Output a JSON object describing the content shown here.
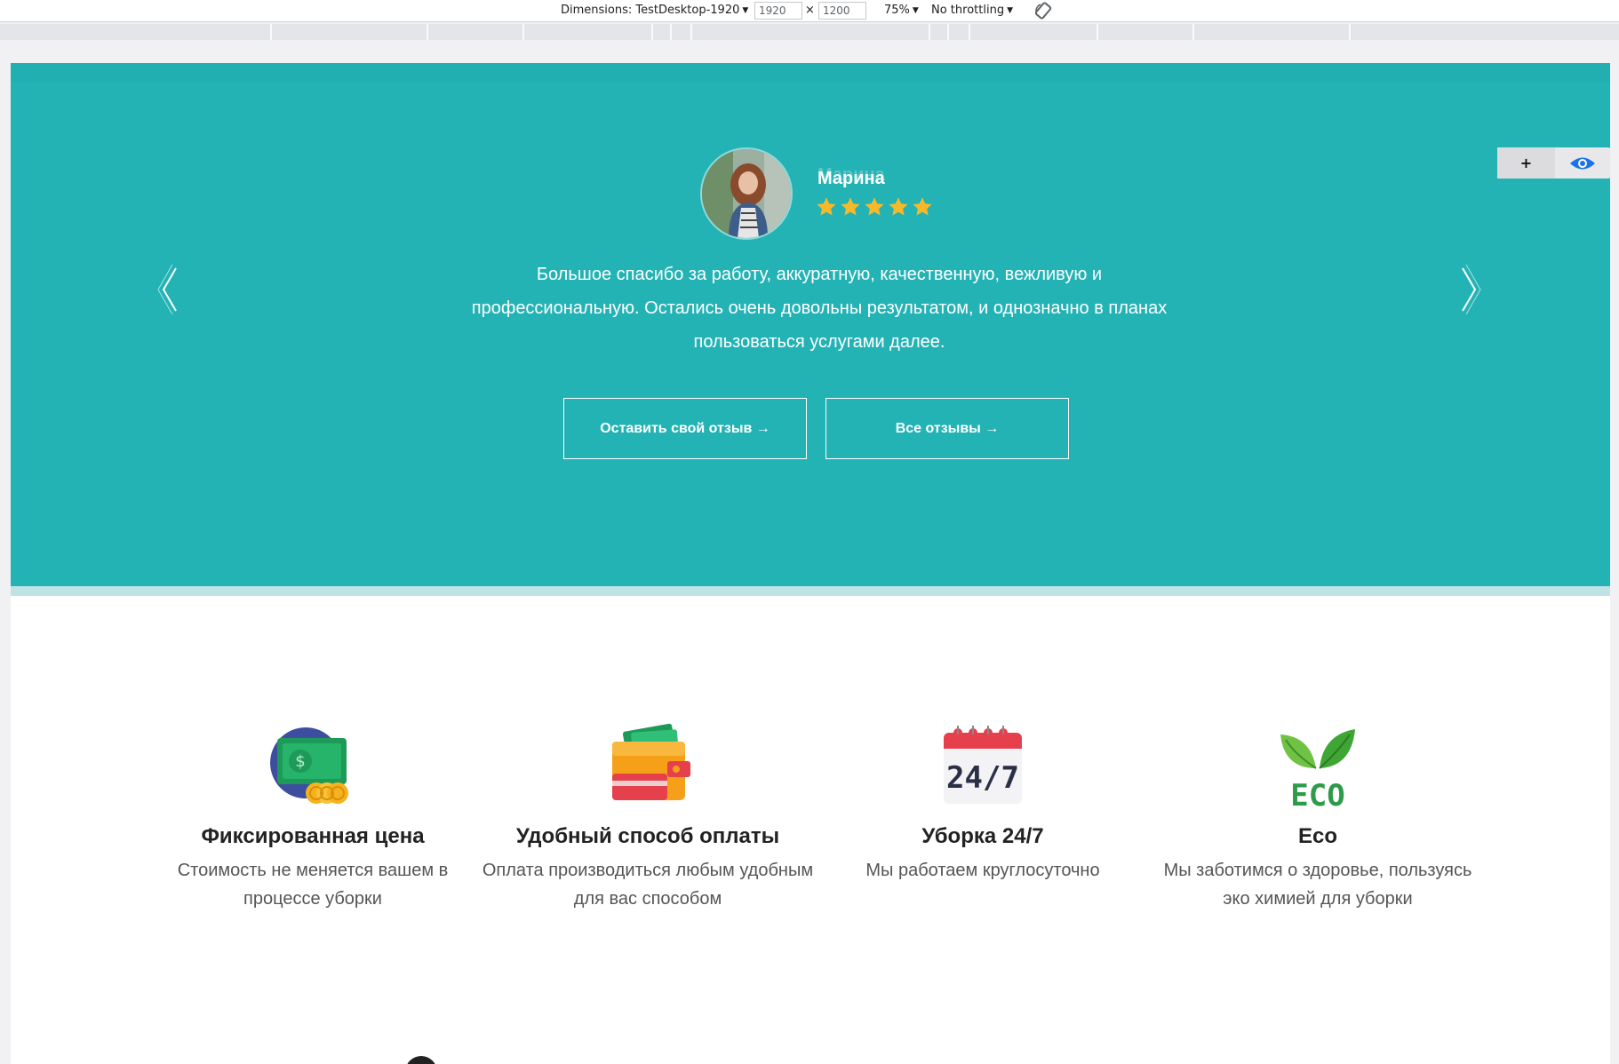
{
  "devtools": {
    "dimensions_label": "Dimensions: TestDesktop-1920",
    "width_value": "1920",
    "times": "×",
    "height_value": "1200",
    "zoom": "75%",
    "throttling": "No throttling",
    "rotate_icon": "rotate-icon"
  },
  "testimonial": {
    "name": "Марина",
    "rating": 5,
    "text": "Большое спасибо за работу, аккуратную, качественную, вежливую и профессиональную. Остались очень довольны результатом, и однозначно в планах пользоваться услугами далее.",
    "leave_review_label": "Оставить свой отзыв →",
    "all_reviews_label": "Все отзывы →",
    "prev_icon": "chevron-left-icon",
    "next_icon": "chevron-right-icon"
  },
  "widget": {
    "plus_label": "+",
    "eye_icon": "eye-icon"
  },
  "features": [
    {
      "title": "Фиксированная цена",
      "desc": "Стоимость не меняется вашем в процессе уборки",
      "icon": "money-icon"
    },
    {
      "title": "Удобный способ оплаты",
      "desc": "Оплата производиться любым удобным для вас способом",
      "icon": "wallet-icon"
    },
    {
      "title": "Уборка 24/7",
      "desc": "Мы работаем круглосуточно",
      "icon": "calendar-icon",
      "icon_text": "24/7"
    },
    {
      "title": "Eco",
      "desc": "Мы заботимся о здоровье, пользуясь эко химией для уборки",
      "icon": "eco-icon",
      "icon_text": "ECO"
    }
  ],
  "colors": {
    "hero_bg": "#24b3b5",
    "star": "#f6b92b",
    "eco_green": "#2e9b48"
  }
}
